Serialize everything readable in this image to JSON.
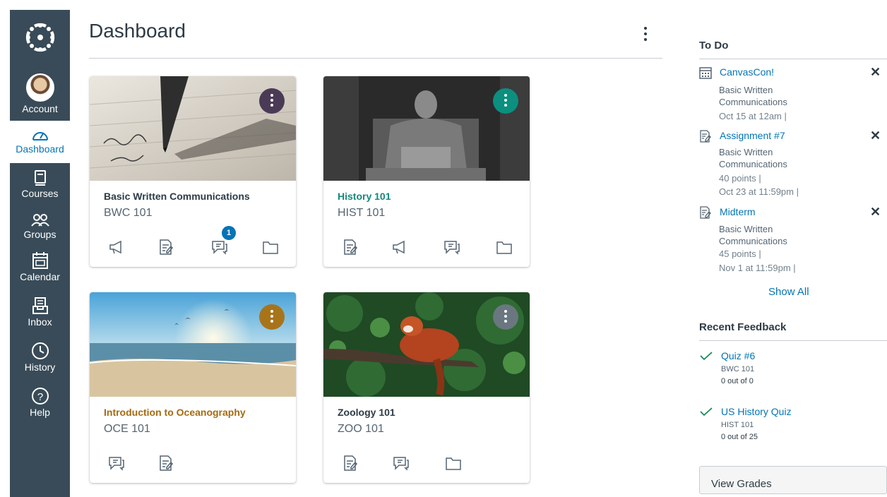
{
  "nav": {
    "items": [
      {
        "label": "Account",
        "icon": "account-avatar"
      },
      {
        "label": "Dashboard",
        "icon": "dashboard-icon"
      },
      {
        "label": "Courses",
        "icon": "courses-icon"
      },
      {
        "label": "Groups",
        "icon": "groups-icon"
      },
      {
        "label": "Calendar",
        "icon": "calendar-icon"
      },
      {
        "label": "Inbox",
        "icon": "inbox-icon"
      },
      {
        "label": "History",
        "icon": "history-icon"
      },
      {
        "label": "Help",
        "icon": "help-icon"
      }
    ],
    "active": "Dashboard",
    "bg_color": "#394b58",
    "active_color": "#0374b5"
  },
  "header": {
    "title": "Dashboard"
  },
  "cards": [
    {
      "title": "Basic Written Communications",
      "code": "BWC 101",
      "title_color": "#2d3b45",
      "menu_color": "#4b3a55",
      "icons": [
        "announcements-icon",
        "assignments-icon",
        "discussions-icon",
        "files-icon"
      ],
      "badge": "1"
    },
    {
      "title": "History 101",
      "code": "HIST 101",
      "title_color": "#128a7c",
      "menu_color": "#0c8f7f",
      "icons": [
        "assignments-icon",
        "announcements-icon",
        "discussions-icon",
        "files-icon"
      ]
    },
    {
      "title": "Introduction to Oceanography",
      "code": "OCE 101",
      "title_color": "#a56a12",
      "menu_color": "#a8741a",
      "icons": [
        "discussions-icon",
        "assignments-icon"
      ]
    },
    {
      "title": "Zoology 101",
      "code": "ZOO 101",
      "title_color": "#2d3b45",
      "menu_color": "#6b7780",
      "icons": [
        "assignments-icon",
        "discussions-icon",
        "files-icon"
      ]
    }
  ],
  "todo": {
    "heading": "To Do",
    "items": [
      {
        "title": "CanvasCon!",
        "icon": "calendar-event-icon",
        "course_line1": "Basic Written",
        "course_line2": "Communications",
        "detail1": "Oct 15 at 12am  |",
        "detail2": ""
      },
      {
        "title": "Assignment #7",
        "icon": "assignment-icon",
        "course_line1": "Basic Written",
        "course_line2": "Communications",
        "detail1": "40 points  |",
        "detail2": "Oct 23 at 11:59pm  |"
      },
      {
        "title": "Midterm",
        "icon": "assignment-icon",
        "course_line1": "Basic Written",
        "course_line2": "Communications",
        "detail1": "45 points  |",
        "detail2": "Nov 1 at 11:59pm  |"
      }
    ],
    "dismiss_label": "✕",
    "show_all": "Show All"
  },
  "feedback": {
    "heading": "Recent Feedback",
    "items": [
      {
        "title": "Quiz #6",
        "course": "BWC 101",
        "score": "0 out of 0"
      },
      {
        "title": "US History Quiz",
        "course": "HIST 101",
        "score": "0 out of 25"
      }
    ],
    "view_grades": "View Grades"
  }
}
